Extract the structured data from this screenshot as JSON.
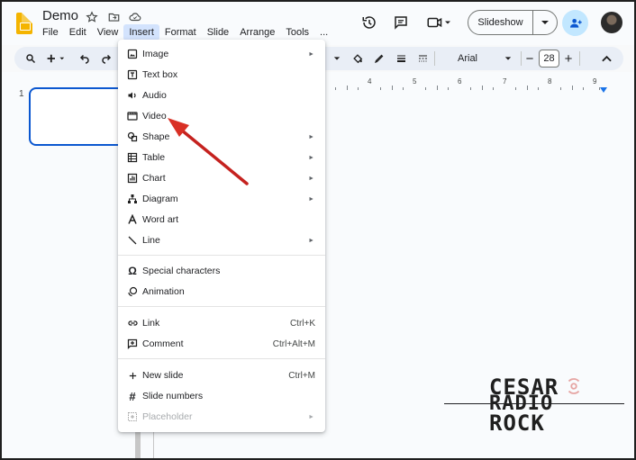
{
  "header": {
    "doc_title": "Demo",
    "menus": [
      "File",
      "Edit",
      "View",
      "Insert",
      "Format",
      "Slide",
      "Arrange",
      "Tools",
      "..."
    ],
    "active_menu": "Insert",
    "slideshow_label": "Slideshow"
  },
  "toolbar": {
    "font": "Arial",
    "font_size": "28",
    "minus": "−",
    "plus": "+"
  },
  "slides": {
    "number": "1"
  },
  "ruler": {
    "labels": [
      "4",
      "5",
      "6",
      "7",
      "8",
      "9"
    ]
  },
  "insert_menu": {
    "items": [
      {
        "label": "Image",
        "icon": "image-icon",
        "submenu": true
      },
      {
        "label": "Text box",
        "icon": "text-box-icon",
        "submenu": false
      },
      {
        "label": "Audio",
        "icon": "audio-icon",
        "submenu": false
      },
      {
        "label": "Video",
        "icon": "video-icon",
        "submenu": false
      },
      {
        "label": "Shape",
        "icon": "shape-icon",
        "submenu": true
      },
      {
        "label": "Table",
        "icon": "table-icon",
        "submenu": true
      },
      {
        "label": "Chart",
        "icon": "chart-icon",
        "submenu": true
      },
      {
        "label": "Diagram",
        "icon": "diagram-icon",
        "submenu": true
      },
      {
        "label": "Word art",
        "icon": "word-art-icon",
        "submenu": false
      },
      {
        "label": "Line",
        "icon": "line-icon",
        "submenu": true
      },
      {
        "label": "Special characters",
        "icon": "omega-icon",
        "submenu": false
      },
      {
        "label": "Animation",
        "icon": "animation-icon",
        "submenu": false
      },
      {
        "label": "Link",
        "icon": "link-icon",
        "shortcut": "Ctrl+K"
      },
      {
        "label": "Comment",
        "icon": "comment-icon",
        "shortcut": "Ctrl+Alt+M"
      },
      {
        "label": "New slide",
        "icon": "plus-icon",
        "shortcut": "Ctrl+M"
      },
      {
        "label": "Slide numbers",
        "icon": "hash-icon",
        "submenu": false
      },
      {
        "label": "Placeholder",
        "icon": "placeholder-icon",
        "submenu": true,
        "disabled": true
      }
    ]
  },
  "watermark": {
    "line1": "CESAR",
    "line2": "RADIO",
    "line3": "ROCK"
  },
  "colors": {
    "accent": "#0b57d0",
    "arrow": "#d93025",
    "menu_active": "#d3e3fd"
  }
}
